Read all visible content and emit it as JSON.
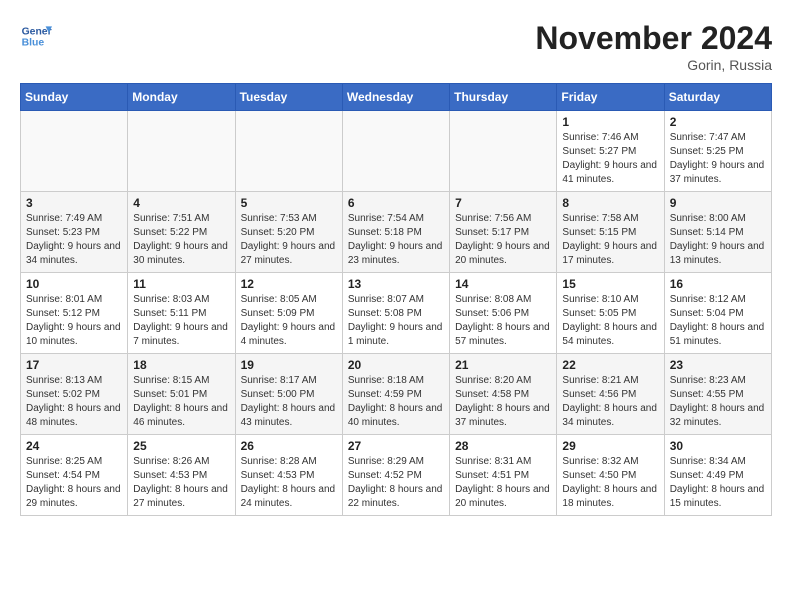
{
  "header": {
    "logo_line1": "General",
    "logo_line2": "Blue",
    "month": "November 2024",
    "location": "Gorin, Russia"
  },
  "days_of_week": [
    "Sunday",
    "Monday",
    "Tuesday",
    "Wednesday",
    "Thursday",
    "Friday",
    "Saturday"
  ],
  "weeks": [
    [
      {
        "day": "",
        "sunrise": "",
        "sunset": "",
        "daylight": ""
      },
      {
        "day": "",
        "sunrise": "",
        "sunset": "",
        "daylight": ""
      },
      {
        "day": "",
        "sunrise": "",
        "sunset": "",
        "daylight": ""
      },
      {
        "day": "",
        "sunrise": "",
        "sunset": "",
        "daylight": ""
      },
      {
        "day": "",
        "sunrise": "",
        "sunset": "",
        "daylight": ""
      },
      {
        "day": "1",
        "sunrise": "Sunrise: 7:46 AM",
        "sunset": "Sunset: 5:27 PM",
        "daylight": "Daylight: 9 hours and 41 minutes."
      },
      {
        "day": "2",
        "sunrise": "Sunrise: 7:47 AM",
        "sunset": "Sunset: 5:25 PM",
        "daylight": "Daylight: 9 hours and 37 minutes."
      }
    ],
    [
      {
        "day": "3",
        "sunrise": "Sunrise: 7:49 AM",
        "sunset": "Sunset: 5:23 PM",
        "daylight": "Daylight: 9 hours and 34 minutes."
      },
      {
        "day": "4",
        "sunrise": "Sunrise: 7:51 AM",
        "sunset": "Sunset: 5:22 PM",
        "daylight": "Daylight: 9 hours and 30 minutes."
      },
      {
        "day": "5",
        "sunrise": "Sunrise: 7:53 AM",
        "sunset": "Sunset: 5:20 PM",
        "daylight": "Daylight: 9 hours and 27 minutes."
      },
      {
        "day": "6",
        "sunrise": "Sunrise: 7:54 AM",
        "sunset": "Sunset: 5:18 PM",
        "daylight": "Daylight: 9 hours and 23 minutes."
      },
      {
        "day": "7",
        "sunrise": "Sunrise: 7:56 AM",
        "sunset": "Sunset: 5:17 PM",
        "daylight": "Daylight: 9 hours and 20 minutes."
      },
      {
        "day": "8",
        "sunrise": "Sunrise: 7:58 AM",
        "sunset": "Sunset: 5:15 PM",
        "daylight": "Daylight: 9 hours and 17 minutes."
      },
      {
        "day": "9",
        "sunrise": "Sunrise: 8:00 AM",
        "sunset": "Sunset: 5:14 PM",
        "daylight": "Daylight: 9 hours and 13 minutes."
      }
    ],
    [
      {
        "day": "10",
        "sunrise": "Sunrise: 8:01 AM",
        "sunset": "Sunset: 5:12 PM",
        "daylight": "Daylight: 9 hours and 10 minutes."
      },
      {
        "day": "11",
        "sunrise": "Sunrise: 8:03 AM",
        "sunset": "Sunset: 5:11 PM",
        "daylight": "Daylight: 9 hours and 7 minutes."
      },
      {
        "day": "12",
        "sunrise": "Sunrise: 8:05 AM",
        "sunset": "Sunset: 5:09 PM",
        "daylight": "Daylight: 9 hours and 4 minutes."
      },
      {
        "day": "13",
        "sunrise": "Sunrise: 8:07 AM",
        "sunset": "Sunset: 5:08 PM",
        "daylight": "Daylight: 9 hours and 1 minute."
      },
      {
        "day": "14",
        "sunrise": "Sunrise: 8:08 AM",
        "sunset": "Sunset: 5:06 PM",
        "daylight": "Daylight: 8 hours and 57 minutes."
      },
      {
        "day": "15",
        "sunrise": "Sunrise: 8:10 AM",
        "sunset": "Sunset: 5:05 PM",
        "daylight": "Daylight: 8 hours and 54 minutes."
      },
      {
        "day": "16",
        "sunrise": "Sunrise: 8:12 AM",
        "sunset": "Sunset: 5:04 PM",
        "daylight": "Daylight: 8 hours and 51 minutes."
      }
    ],
    [
      {
        "day": "17",
        "sunrise": "Sunrise: 8:13 AM",
        "sunset": "Sunset: 5:02 PM",
        "daylight": "Daylight: 8 hours and 48 minutes."
      },
      {
        "day": "18",
        "sunrise": "Sunrise: 8:15 AM",
        "sunset": "Sunset: 5:01 PM",
        "daylight": "Daylight: 8 hours and 46 minutes."
      },
      {
        "day": "19",
        "sunrise": "Sunrise: 8:17 AM",
        "sunset": "Sunset: 5:00 PM",
        "daylight": "Daylight: 8 hours and 43 minutes."
      },
      {
        "day": "20",
        "sunrise": "Sunrise: 8:18 AM",
        "sunset": "Sunset: 4:59 PM",
        "daylight": "Daylight: 8 hours and 40 minutes."
      },
      {
        "day": "21",
        "sunrise": "Sunrise: 8:20 AM",
        "sunset": "Sunset: 4:58 PM",
        "daylight": "Daylight: 8 hours and 37 minutes."
      },
      {
        "day": "22",
        "sunrise": "Sunrise: 8:21 AM",
        "sunset": "Sunset: 4:56 PM",
        "daylight": "Daylight: 8 hours and 34 minutes."
      },
      {
        "day": "23",
        "sunrise": "Sunrise: 8:23 AM",
        "sunset": "Sunset: 4:55 PM",
        "daylight": "Daylight: 8 hours and 32 minutes."
      }
    ],
    [
      {
        "day": "24",
        "sunrise": "Sunrise: 8:25 AM",
        "sunset": "Sunset: 4:54 PM",
        "daylight": "Daylight: 8 hours and 29 minutes."
      },
      {
        "day": "25",
        "sunrise": "Sunrise: 8:26 AM",
        "sunset": "Sunset: 4:53 PM",
        "daylight": "Daylight: 8 hours and 27 minutes."
      },
      {
        "day": "26",
        "sunrise": "Sunrise: 8:28 AM",
        "sunset": "Sunset: 4:53 PM",
        "daylight": "Daylight: 8 hours and 24 minutes."
      },
      {
        "day": "27",
        "sunrise": "Sunrise: 8:29 AM",
        "sunset": "Sunset: 4:52 PM",
        "daylight": "Daylight: 8 hours and 22 minutes."
      },
      {
        "day": "28",
        "sunrise": "Sunrise: 8:31 AM",
        "sunset": "Sunset: 4:51 PM",
        "daylight": "Daylight: 8 hours and 20 minutes."
      },
      {
        "day": "29",
        "sunrise": "Sunrise: 8:32 AM",
        "sunset": "Sunset: 4:50 PM",
        "daylight": "Daylight: 8 hours and 18 minutes."
      },
      {
        "day": "30",
        "sunrise": "Sunrise: 8:34 AM",
        "sunset": "Sunset: 4:49 PM",
        "daylight": "Daylight: 8 hours and 15 minutes."
      }
    ]
  ]
}
